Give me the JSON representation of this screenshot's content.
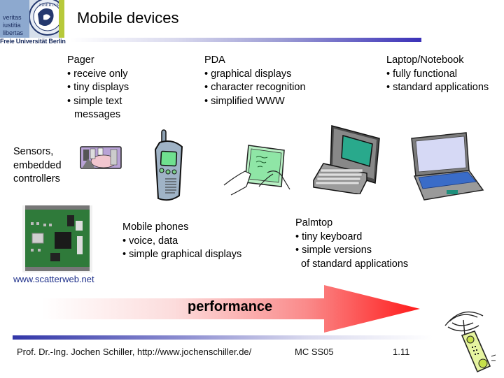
{
  "header": {
    "logo": {
      "motto": [
        "veritas",
        "iustitia",
        "libertas"
      ],
      "university": "Freie Universität Berlin",
      "seal_text": "LIBERTAS"
    },
    "title": "Mobile devices"
  },
  "devices": {
    "pager": {
      "title": "Pager",
      "items": [
        "• receive only",
        "• tiny displays",
        "• simple text",
        "  messages"
      ]
    },
    "pda": {
      "title": "PDA",
      "items": [
        "• graphical displays",
        "• character recognition",
        "• simplified WWW"
      ]
    },
    "laptop": {
      "title": "Laptop/Notebook",
      "items": [
        "• fully functional",
        "• standard applications"
      ]
    },
    "sensors": {
      "lines": [
        "Sensors,",
        "embedded",
        "controllers"
      ]
    },
    "mobile_phones": {
      "title": "Mobile phones",
      "items": [
        "• voice, data",
        "• simple graphical displays"
      ]
    },
    "palmtop": {
      "title": "Palmtop",
      "items": [
        "• tiny keyboard",
        "• simple versions",
        "  of standard applications"
      ]
    },
    "scatterweb_label": "www.scatterweb.net"
  },
  "arrow": {
    "label": "performance",
    "color": "#ff1a1a"
  },
  "footer": {
    "author": "Prof. Dr.-Ing. Jochen Schiller, http://www.jochenschiller.de/",
    "course": "MC SS05",
    "page": "1.11"
  },
  "colors": {
    "title_bar_end": "#3b31b8",
    "footer_bar_start": "#3236a8",
    "link": "#1d2f8a"
  }
}
